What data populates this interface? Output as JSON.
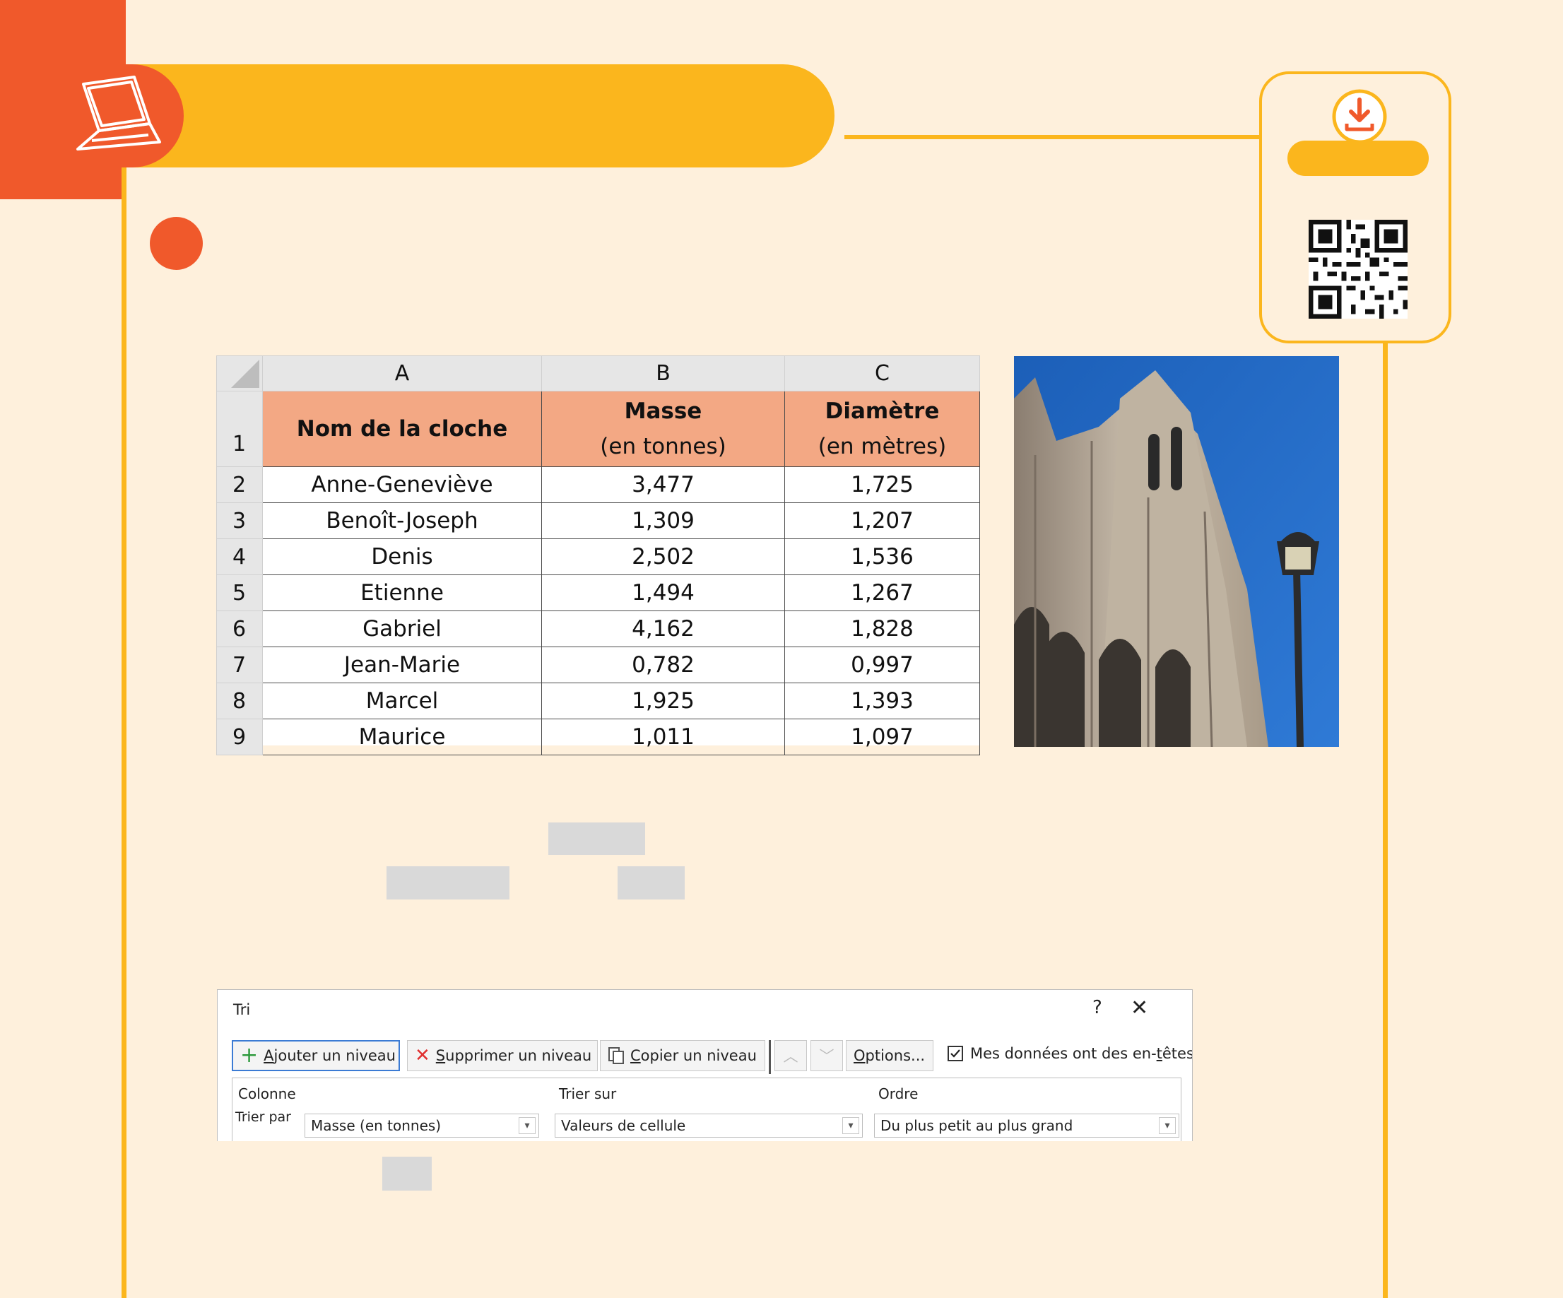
{
  "colors": {
    "orange": "#f0592b",
    "yellow": "#fbb61d",
    "background": "#fef0dc",
    "header_fill": "#f3a884"
  },
  "icons": {
    "badge": "laptop-icon",
    "download": "download-icon",
    "qr": "qr-code"
  },
  "spreadsheet": {
    "column_headers": [
      "A",
      "B",
      "C"
    ],
    "header_row_number": "1",
    "headers": {
      "name": "Nom de la cloche",
      "mass_title": "Masse",
      "mass_unit": "(en tonnes)",
      "diameter_title": "Diamètre",
      "diameter_unit": "(en mètres)"
    },
    "rows": [
      {
        "num": "2",
        "name": "Anne-Geneviève",
        "mass": "3,477",
        "diameter": "1,725"
      },
      {
        "num": "3",
        "name": "Benoît-Joseph",
        "mass": "1,309",
        "diameter": "1,207"
      },
      {
        "num": "4",
        "name": "Denis",
        "mass": "2,502",
        "diameter": "1,536"
      },
      {
        "num": "5",
        "name": "Etienne",
        "mass": "1,494",
        "diameter": "1,267"
      },
      {
        "num": "6",
        "name": "Gabriel",
        "mass": "4,162",
        "diameter": "1,828"
      },
      {
        "num": "7",
        "name": "Jean-Marie",
        "mass": "0,782",
        "diameter": "0,997"
      },
      {
        "num": "8",
        "name": "Marcel",
        "mass": "1,925",
        "diameter": "1,393"
      },
      {
        "num": "9",
        "name": "Maurice",
        "mass": "1,011",
        "diameter": "1,097"
      }
    ]
  },
  "dialog": {
    "title": "Tri",
    "help": "?",
    "close": "✕",
    "buttons": {
      "add_key": "A",
      "add_rest": "jouter un niveau",
      "delete_key": "S",
      "delete_rest": "upprimer un niveau",
      "copy_key": "C",
      "copy_rest": "opier un niveau",
      "options_key": "O",
      "options_rest": "ptions..."
    },
    "checkbox": {
      "label_start": "Mes données ont des en-",
      "label_key": "t",
      "label_end": "êtes",
      "checked": true
    },
    "columns": {
      "colonne": "Colonne",
      "trier_sur": "Trier sur",
      "ordre": "Ordre"
    },
    "row": {
      "label": "Trier par",
      "column_value": "Masse  (en tonnes)",
      "sort_on_value": "Valeurs de cellule",
      "order_value": "Du plus petit au plus grand"
    }
  }
}
